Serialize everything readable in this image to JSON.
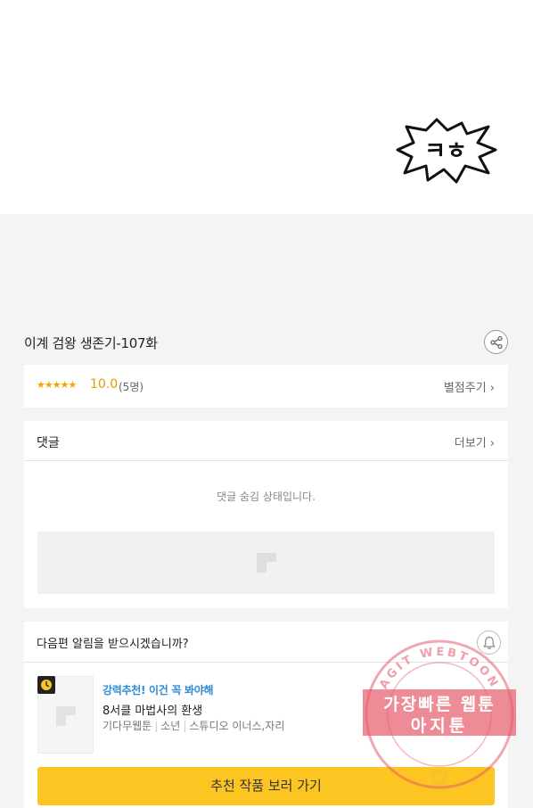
{
  "comic": {
    "sfx_text": "ㅋㅎ"
  },
  "episode": {
    "title": "이계 검왕 생존기-107화"
  },
  "rating": {
    "stars": "★★★★★",
    "score": "10.0",
    "count": "(5명)",
    "rate_link": "별점주기 ›"
  },
  "comments": {
    "label": "댓글",
    "more_link": "더보기 ›",
    "hidden_message": "댓글 숨김 상태입니다."
  },
  "notify": {
    "question": "다음편 알림을 받으시겠습니까?"
  },
  "recommendation": {
    "tag": "강력추천! 이건 꼭 봐야해",
    "title": "8서클 마법사의 환생",
    "meta": [
      "기다무웹툰",
      "소년",
      "스튜디오 이너스,자리"
    ],
    "button_label": "추천 작품 보러 가기"
  },
  "watermark": {
    "ring_text": "AGIT WEBTOON",
    "line1": "가장빠른 웹툰",
    "line2": "아지툰"
  },
  "colors": {
    "accent_yellow": "#fcc521",
    "star_orange": "#f5a300",
    "tag_blue": "#2e8bd6",
    "stamp_red": "#e65f6e"
  }
}
